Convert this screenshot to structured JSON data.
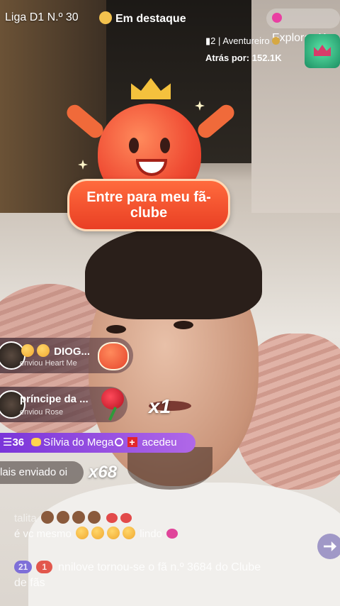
{
  "topbar": {
    "league": "Liga D1 N.º 30",
    "featured": "Em destaque",
    "explore": "Explorar",
    "close": "X"
  },
  "rank": {
    "position": "2",
    "separator": "|",
    "tier": "Aventureiro",
    "behind": "Atrás por: 152.1K"
  },
  "fanclub": {
    "label": "Entre para meu fã-clube"
  },
  "gifts": [
    {
      "name": "DIOG...",
      "action": "enviou Heart Me"
    },
    {
      "name": "príncipe da ...",
      "action": "enviou Rose",
      "combo": "x1"
    }
  ],
  "join": {
    "level": "36",
    "name": "Sílvia do Mega",
    "action": "acedeu"
  },
  "chat_pill": "lais enviado oi",
  "combo_pill": "x68",
  "chat": [
    {
      "text": "talita"
    },
    {
      "text": "é vc mesmo",
      "tail": "lindo"
    },
    {
      "badge_level": "21",
      "badge_fan": "1",
      "text": "nnilove tornou-se o fã n.º 3684 do Clube"
    },
    {
      "text": "de fãs"
    }
  ]
}
